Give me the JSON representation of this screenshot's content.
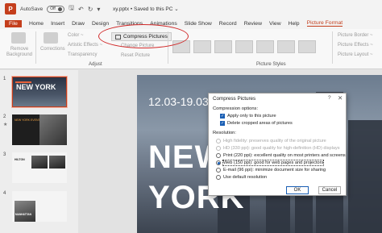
{
  "app": {
    "icon_letter": "P",
    "autosave_label": "AutoSave",
    "autosave_state": "Off",
    "doc_title": "xy.pptx • Saved to this PC ⌄"
  },
  "tabs": [
    "File",
    "Home",
    "Insert",
    "Draw",
    "Design",
    "Transitions",
    "Animations",
    "Slide Show",
    "Record",
    "Review",
    "View",
    "Help",
    "Picture Format"
  ],
  "active_tab": "Picture Format",
  "ribbon": {
    "remove_background": "Remove Background",
    "corrections": "Corrections",
    "color": "Color ~",
    "artistic_effects": "Artistic Effects ~",
    "transparency": "Transparency",
    "compress_pictures": "Compress Pictures",
    "change_picture": "Change Picture",
    "reset_picture": "Reset Picture",
    "adjust_label": "Adjust",
    "picture_styles_label": "Picture Styles",
    "picture_border": "Picture Border ~",
    "picture_effects": "Picture Effects ~",
    "picture_layout": "Picture Layout ~"
  },
  "slides": [
    {
      "num": "1",
      "title": "NEW YORK"
    },
    {
      "num": "2",
      "title": "NEW YORK EVENT"
    },
    {
      "num": "3",
      "title": "HILTON"
    },
    {
      "num": "4",
      "title": "MANHATTAN"
    }
  ],
  "slide_main": {
    "date": "12.03-19.03",
    "line1": "NEW",
    "line2": "YORK"
  },
  "dialog": {
    "title": "Compress Pictures",
    "help": "?",
    "close": "✕",
    "compression_options_label": "Compression options:",
    "apply_only": "Apply only to this picture",
    "delete_cropped": "Delete cropped areas of pictures",
    "resolution_label": "Resolution:",
    "options": [
      {
        "label": "High fidelity: preserves quality of the original picture",
        "enabled": false,
        "selected": false
      },
      {
        "label": "HD (330 ppi): good quality for high-definition (HD) displays",
        "enabled": false,
        "selected": false
      },
      {
        "label": "Print (220 ppi): excellent quality on most printers and screens",
        "enabled": true,
        "selected": false
      },
      {
        "label": "Web (150 ppi): good for web pages and projectors",
        "enabled": true,
        "selected": true
      },
      {
        "label": "E-mail (96 ppi): minimize document size for sharing",
        "enabled": true,
        "selected": false
      },
      {
        "label": "Use default resolution",
        "enabled": true,
        "selected": false
      }
    ],
    "ok_label": "OK",
    "cancel_label": "Cancel"
  },
  "colors": {
    "accent": "#c43e1c",
    "annotation": "#d12a2a",
    "checkbox": "#1a5fb4"
  }
}
